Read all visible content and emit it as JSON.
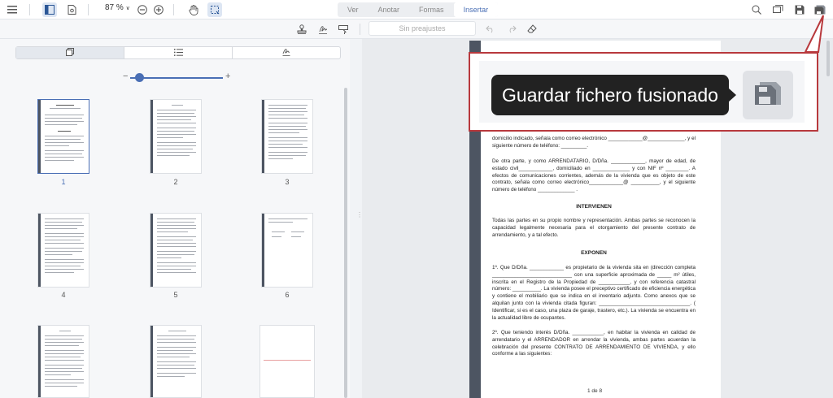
{
  "toolbar": {
    "zoom": "87 %",
    "tabs": [
      "Ver",
      "Anotar",
      "Formas",
      "Insertar"
    ],
    "active_tab": "Insertar"
  },
  "subtoolbar": {
    "preset_placeholder": "Sin preajustes"
  },
  "thumbnails": [
    "1",
    "2",
    "3",
    "4",
    "5",
    "6"
  ],
  "document": {
    "p1": "domicilio indicado, señala como correo electrónico ____________@_____________, y el siguiente número de teléfono: _________.",
    "p2": "De otra parte, y como ARRENDATARIO, D/Dña. ____________, mayor de edad, de estado civil____________, domiciliado en _____________ y con NIF nº ________. A efectos de comunicaciones corrientes, además de la vivienda que es objeto de este contrato, señala como correo electrónico____________@ __________, y el siguiente número de teléfono _____________ .",
    "h1": "INTERVIENEN",
    "p3": "Todas las partes en su propio nombre y representación. Ambas partes se reconocen la capacidad legalmente necesaria para el otorgamiento del presente contrato de arrendamiento, y a tal efecto.",
    "h2": "EXPONEN",
    "p4": "1º. Que D/Dña. ____________ es propietario de la vivienda sita en (dirección completa ____________________________ con una superficie aproximada de _____ m² útiles, inscrita en el Registro de la Propiedad de ___________, y con referencia catastral número: __________. La vivienda posee el preceptivo certificado de eficiencia energética y contiene el mobiliario que se indica en el inventario adjunto. Como anexos que se alquilan junto con la vivienda citada figuran: ________________________________. ( Identificar, si es el caso, una plaza de garaje, trastero, etc.). La vivienda se encuentra en la actualidad libre de ocupantes.",
    "p5": "2º. Que teniendo interés D/Dña. ___________, en habitar la vivienda en calidad de arrendatario y el ARRENDADOR en arrendar la vivienda, ambas partes acuerdan la celebración del presente CONTRATO DE ARRENDAMIENTO DE VIVIENDA, y ello conforme a las siguientes:",
    "page_count": "1 de 8"
  },
  "callout": {
    "tooltip": "Guardar fichero fusionado"
  },
  "colors": {
    "accent": "#4a6fb5",
    "callout_border": "#b8393d",
    "tooltip_bg": "#222222"
  }
}
